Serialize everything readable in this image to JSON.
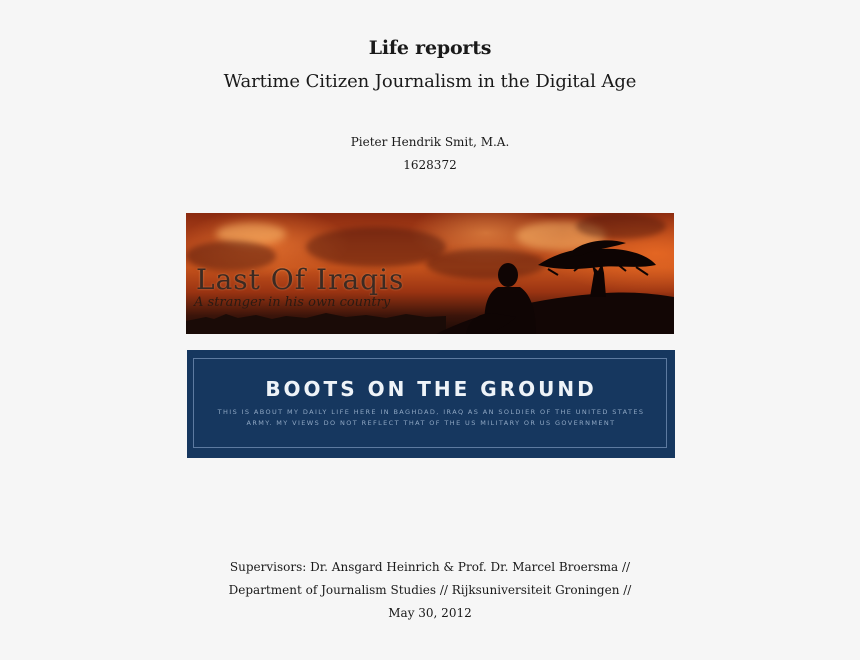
{
  "document": {
    "title": "Life reports",
    "subtitle": "Wartime Citizen Journalism in the Digital Age",
    "author": "Pieter Hendrik Smit, M.A.",
    "student_id": "1628372",
    "supervisors": "Supervisors: Dr. Ansgard Heinrich & Prof. Dr. Marcel Broersma //",
    "department": "Department of Journalism Studies //  Rijksuniversiteit Groningen //",
    "date": "May 30, 2012"
  },
  "banner_last_of_iraqis": {
    "title": "Last Of Iraqis",
    "tagline": "A stranger in his own country"
  },
  "banner_boots": {
    "title": "BOOTS ON THE GROUND",
    "description": "This is about my daily life here in Baghdad, Iraq as an soldier of the United States Army. My views do not reflect that of the US Military or US Government"
  },
  "colors": {
    "page_background": "#f6f6f6",
    "boots_banner_navy": "#16375f",
    "sunset_orange": "#c4521c"
  }
}
